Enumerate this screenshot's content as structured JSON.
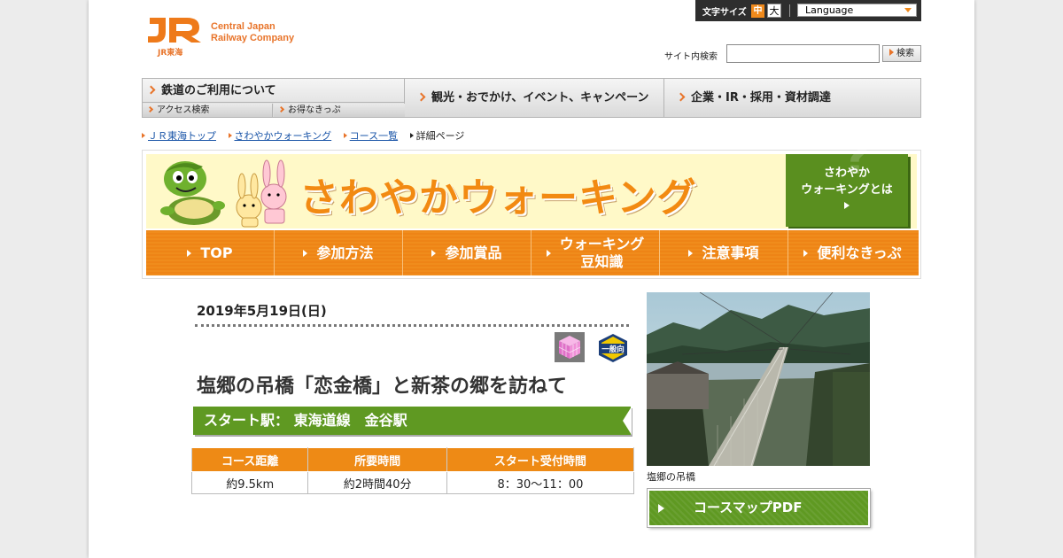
{
  "header": {
    "logo_lines": [
      "Central Japan",
      "Railway Company"
    ],
    "logo_sub": "JR東海",
    "font_size_label": "文字サイズ",
    "font_size_options": [
      "中",
      "大"
    ],
    "language_label": "Language",
    "search_label": "サイト内検索",
    "search_placeholder": "",
    "search_button": "検索"
  },
  "main_nav": {
    "rail": {
      "label": "鉄道のご利用について",
      "subs": [
        "アクセス検索",
        "お得なきっぷ"
      ]
    },
    "items": [
      "観光・おでかけ、イベント、キャンペーン",
      "企業・IR・採用・資材調達"
    ]
  },
  "breadcrumb": {
    "links": [
      "ＪＲ東海トップ",
      "さわやかウォーキング",
      "コース一覧"
    ],
    "current": "詳細ページ"
  },
  "banner": {
    "title": "さわやかウォーキング",
    "what_lines": [
      "さわやか",
      "ウォーキングとは"
    ],
    "nav": [
      {
        "lines": [
          "TOP"
        ]
      },
      {
        "lines": [
          "参加方法"
        ]
      },
      {
        "lines": [
          "参加賞品"
        ]
      },
      {
        "lines": [
          "ウォーキング",
          "豆知識"
        ]
      },
      {
        "lines": [
          "注意事項"
        ]
      },
      {
        "lines": [
          "便利なきっぷ"
        ]
      }
    ]
  },
  "course": {
    "date": "2019年5月19日(日)",
    "badge_general": "一般向",
    "title": "塩郷の吊橋「恋金橋」と新茶の郷を訪ねて",
    "start_station": "スタート駅： 東海道線　金谷駅",
    "table": {
      "headers": [
        "コース距離",
        "所要時間",
        "スタート受付時間"
      ],
      "values": [
        "約9.5km",
        "約2時間40分",
        "8：30～11：00"
      ]
    },
    "photo_caption": "塩郷の吊橋",
    "pdf_button": "コースマップPDF"
  },
  "colors": {
    "accent_orange": "#ee8a15",
    "accent_green": "#5f9922",
    "banner_bg": "#fff9c8",
    "link_blue": "#1a55a8"
  }
}
